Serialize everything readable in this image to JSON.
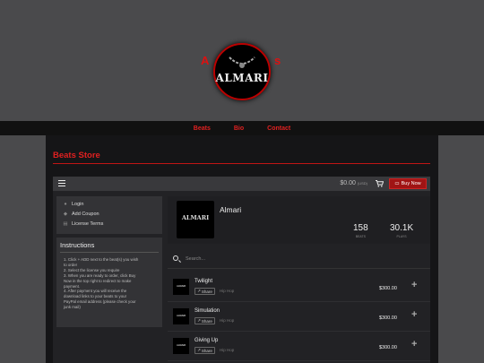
{
  "header": {
    "logo_text": "ALMARI",
    "logo_left_fragment": "A",
    "logo_right_fragment": "s"
  },
  "nav": {
    "items": [
      "Beats",
      "Bio",
      "Contact"
    ]
  },
  "store": {
    "title": "Beats Store"
  },
  "topbar": {
    "cart_amount": "$0.00",
    "cart_currency": "(USD)",
    "buy_label": "Buy Now"
  },
  "sidebar": {
    "items": [
      {
        "label": "Login",
        "icon": "user-icon"
      },
      {
        "label": "Add Coupon",
        "icon": "tag-icon"
      },
      {
        "label": "License Terms",
        "icon": "document-icon"
      }
    ]
  },
  "instructions": {
    "title": "Instructions",
    "steps": [
      "1. Click + ADD next to the beat(s) you wish",
      "    to order",
      "2. Select the license you require",
      "3. When you are ready to order, click Buy",
      "    Now in the top right to redirect to make",
      "    payment.",
      "4. After payment you will receive the",
      "    download links to your beats to your",
      "    PayPal email address (please check your",
      "    junk mail)"
    ]
  },
  "profile": {
    "name": "Almari",
    "avatar_text": "ALMARI",
    "beats_count": "158",
    "beats_label": "BEATS",
    "plays_count": "30.1K",
    "plays_label": "PLAYS"
  },
  "search": {
    "placeholder": "Search..."
  },
  "tracks": [
    {
      "name": "Twilight",
      "genre": "Hip Hop",
      "price": "$300.00",
      "share": "Share",
      "thumb": "ALMARI"
    },
    {
      "name": "Simulation",
      "genre": "Hip Hop",
      "price": "$300.00",
      "share": "Share",
      "thumb": "ALMARI"
    },
    {
      "name": "Giving Up",
      "genre": "Hip Hop",
      "price": "$300.00",
      "share": "Share",
      "thumb": "ALMARI"
    }
  ],
  "colors": {
    "accent": "#e02020",
    "buy_button": "#a01414"
  }
}
